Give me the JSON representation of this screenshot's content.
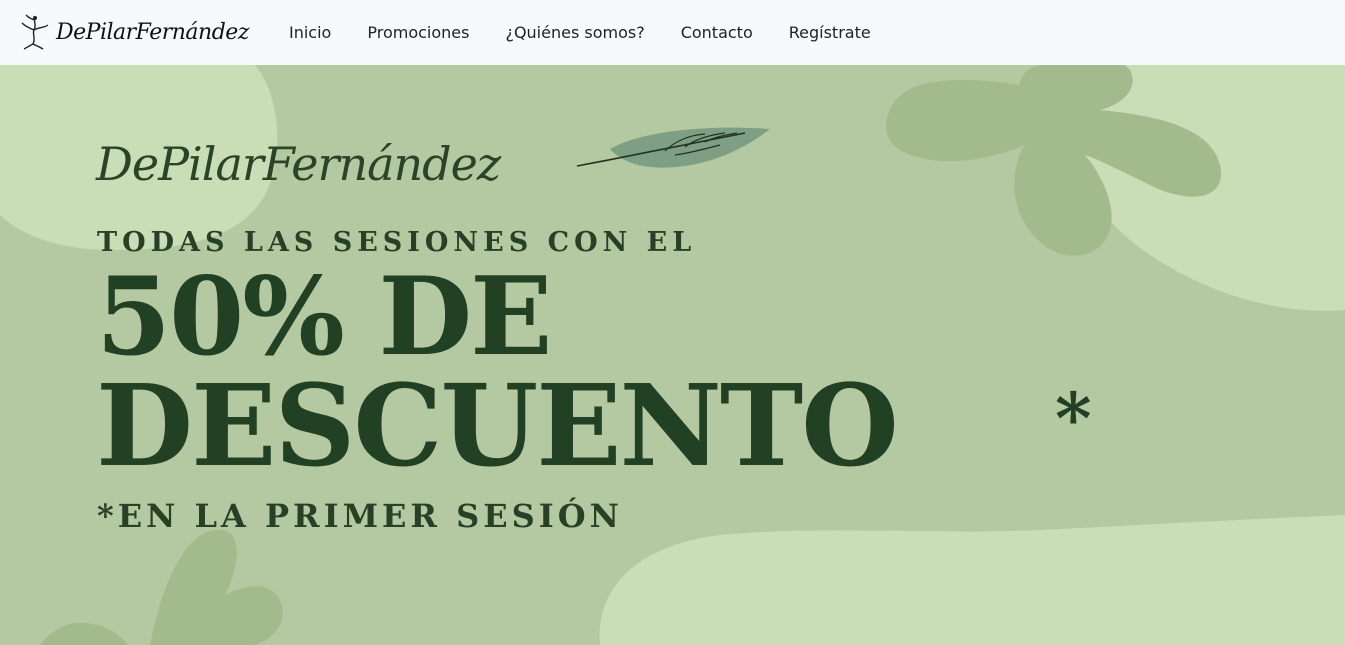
{
  "brand": {
    "name": "DePilarFernández",
    "logo_icon": "dancer-icon"
  },
  "nav": {
    "items": [
      {
        "label": "Inicio"
      },
      {
        "label": "Promociones"
      },
      {
        "label": "¿Quiénes somos?"
      },
      {
        "label": "Contacto"
      },
      {
        "label": "Regístrate"
      }
    ]
  },
  "hero": {
    "script_title": "DePilarFernández",
    "line1": "TODAS LAS SESIONES CON EL",
    "headline_1": "50% DE",
    "headline_2": "DESCUENTO",
    "asterisk": "*",
    "footnote": "*EN LA PRIMER SESIÓN",
    "leaf_icon": "leaf-icon"
  },
  "colors": {
    "nav_bg": "#f8f9fb",
    "hero_bg": "#b4c9a1",
    "light_blob": "#c9ddb6",
    "flower": "#9fb88c",
    "text_dark_green": "#224024",
    "leaf": "#7f9f84"
  }
}
